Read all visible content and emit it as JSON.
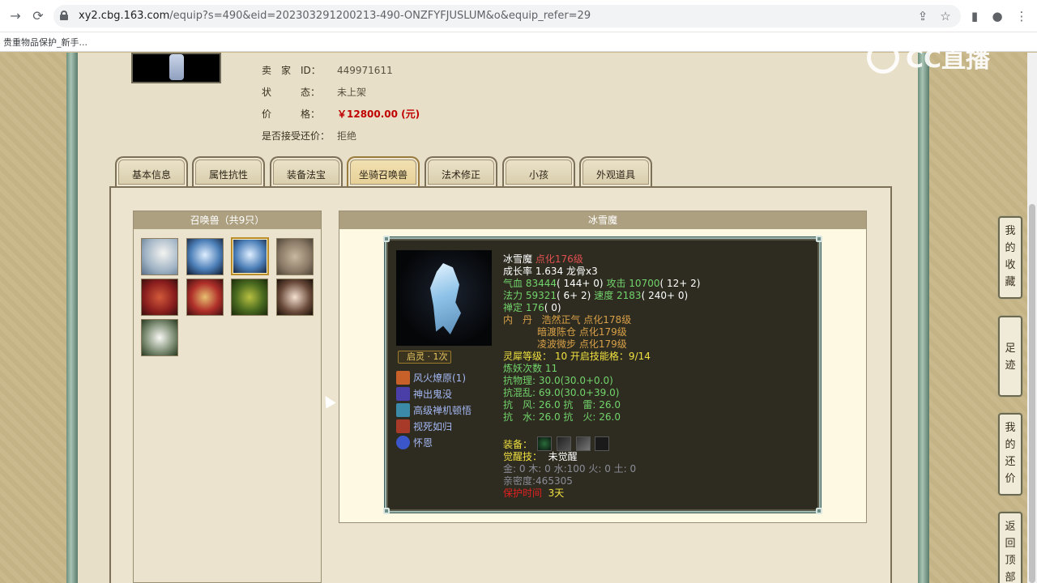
{
  "browser": {
    "url_host": "xy2.cbg.163.com",
    "url_path": "/equip?s=490&eid=202303291200213-490-ONZFYFJUSLUM&o&equip_refer=29",
    "bookmark": "贵重物品保护_新手...",
    "back_icon": "back-arrow-icon",
    "reload_icon": "reload-icon"
  },
  "watermark": "CC直播",
  "seller": {
    "id_label": "卖　家　ID：",
    "id_value": "449971611",
    "status_label": "状　　　态：",
    "status_value": "未上架",
    "price_label": "价　　　格：",
    "price_value": "￥12800.00 (元)",
    "counter_label": "是否接受还价：",
    "counter_value": "拒绝"
  },
  "tabs": [
    {
      "label": "基本信息"
    },
    {
      "label": "属性抗性"
    },
    {
      "label": "装备法宝"
    },
    {
      "label": "坐骑召唤兽",
      "active": true
    },
    {
      "label": "法术修正"
    },
    {
      "label": "小孩"
    },
    {
      "label": "外观道具"
    }
  ],
  "pets_panel": {
    "title": "召唤兽（共9只）",
    "pets": [
      {
        "name": "eagle"
      },
      {
        "name": "ice-demon"
      },
      {
        "name": "ice-demon-selected",
        "selected": true
      },
      {
        "name": "rabbit"
      },
      {
        "name": "red-demon"
      },
      {
        "name": "lion-dancer"
      },
      {
        "name": "green-ogre"
      },
      {
        "name": "lady"
      },
      {
        "name": "panda"
      }
    ]
  },
  "detail_panel": {
    "title": "冰雪魔",
    "name": "冰雪魔",
    "name_suffix": "点化176级",
    "growth": "成长率 1.634 龙骨x3",
    "hp_label": "气血",
    "hp_value": "83444",
    "hp_extra": "( 144+ 0)",
    "atk_label": "攻击",
    "atk_value": "10700",
    "atk_extra": "( 12+ 2)",
    "mp_label": "法力",
    "mp_value": "59321",
    "mp_extra": "( 6+ 2)",
    "spd_label": "速度",
    "spd_value": "2183",
    "spd_extra": "( 240+ 0)",
    "zen_label": "禅定",
    "zen_value": "176",
    "zen_extra": "( 0)",
    "neidan_label": "内　丹",
    "neidan": [
      "浩然正气 点化178级",
      "暗渡陈仓 点化179级",
      "凌波微步 点化179级"
    ],
    "spirit_label": "灵犀等级：",
    "spirit_value": "10 开启技能格：9/14",
    "refine": "炼妖次数 11",
    "res_phys": "抗物理: 30.0(30.0+0.0)",
    "res_chaos": "抗混乱: 69.0(30.0+39.0)",
    "res_wind_thunder": "抗　风: 26.0 抗　雷: 26.0",
    "res_water_fire": "抗　水: 26.0 抗　火: 26.0",
    "equip_label": "装备：",
    "awaken_label": "觉醒技：",
    "awaken_value": "未觉醒",
    "elements": "金: 0 木: 0 水:100 火: 0 土: 0",
    "intimacy": "亲密度:465305",
    "protect_label": "保护时间",
    "protect_value": "3天",
    "qiling": "启灵 · 1次",
    "skills": [
      {
        "name": "风火燎原(1)",
        "color": "#c8602a"
      },
      {
        "name": "神出鬼没",
        "color": "#4a3ea8"
      },
      {
        "name": "高级禅机顿悟",
        "color": "#3a8aa8"
      },
      {
        "name": "视死如归",
        "color": "#a83a2a"
      },
      {
        "name": "怀恩",
        "color": "#3a56c8"
      }
    ]
  },
  "sidebar": [
    {
      "label": [
        "我",
        "的",
        "收",
        "藏"
      ]
    },
    {
      "label": [
        "足",
        "迹"
      ]
    },
    {
      "label": [
        "我",
        "的",
        "还",
        "价"
      ]
    },
    {
      "label": [
        "返",
        "回",
        "顶",
        "部"
      ]
    }
  ]
}
